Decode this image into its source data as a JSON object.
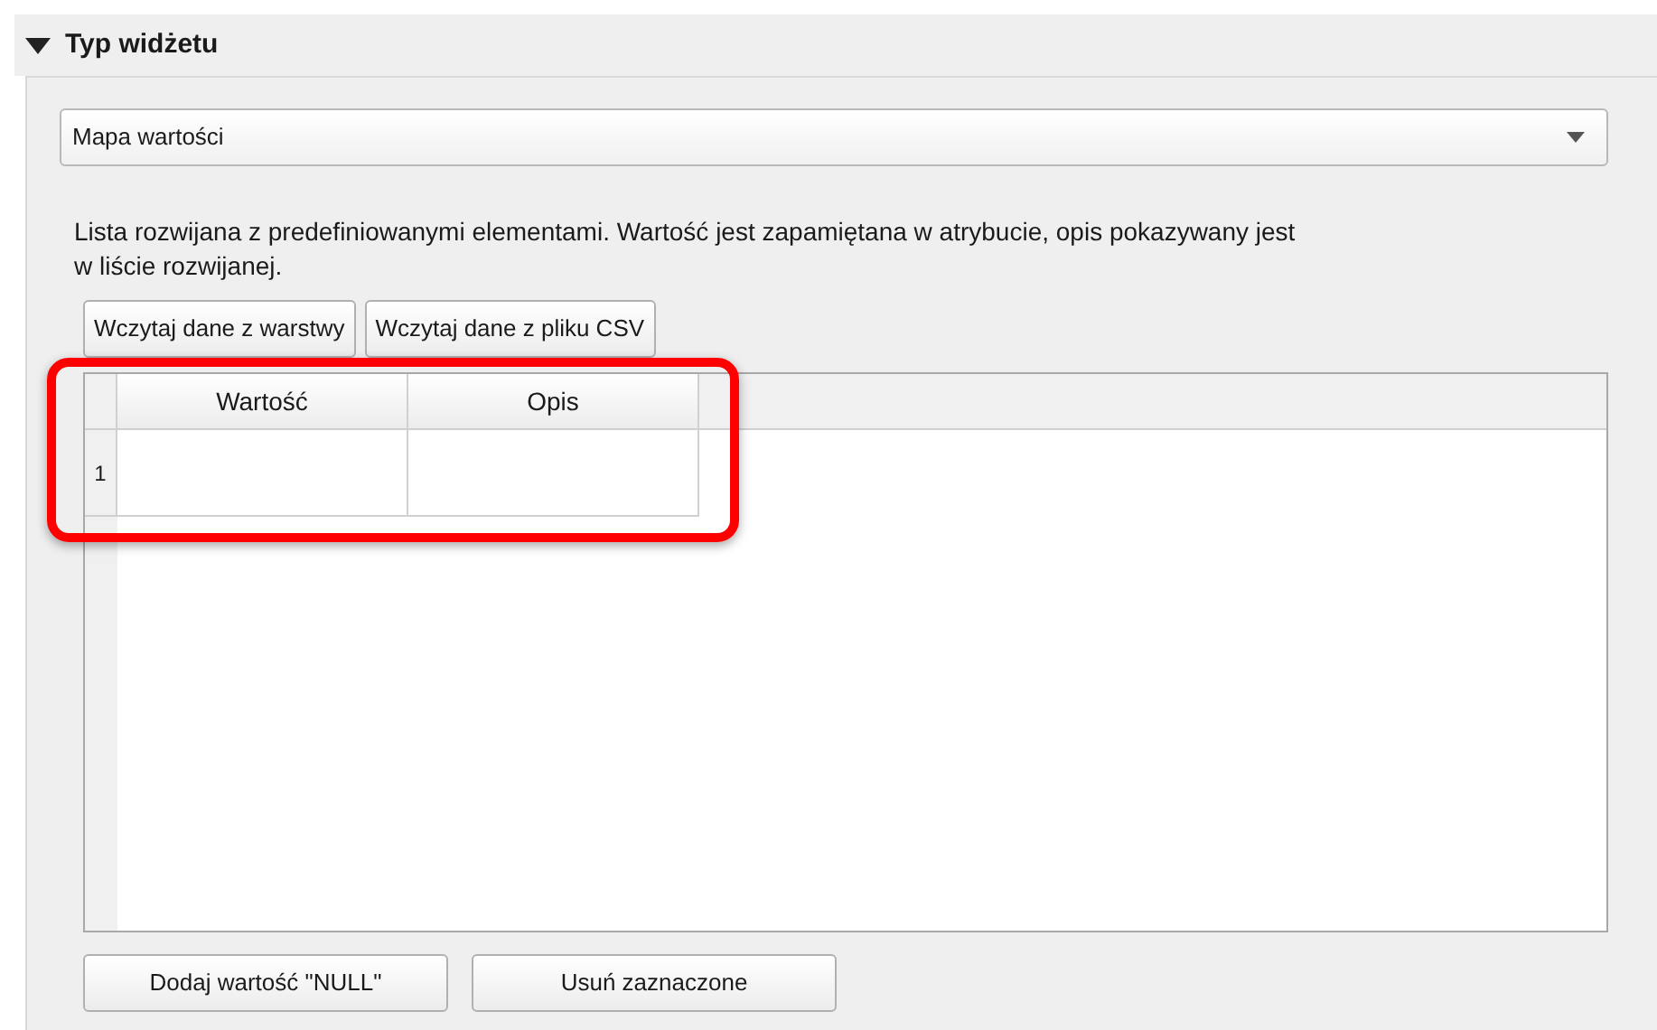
{
  "section": {
    "title": "Typ widżetu",
    "expanded": true
  },
  "widget_type": {
    "value": "Mapa wartości"
  },
  "description": "Lista rozwijana z predefiniowanymi elementami. Wartość jest zapamiętana w atrybucie, opis pokazywany jest w liście rozwijanej.",
  "load_buttons": [
    "Wczytaj dane z warstwy",
    "Wczytaj dane z pliku CSV"
  ],
  "table": {
    "highlighted": true,
    "columns": [
      "Wartość",
      "Opis"
    ],
    "rows": [
      {
        "number": "1"
      }
    ]
  },
  "bottom_buttons": [
    "Dodaj wartość \"NULL\"",
    "Usuń zaznaczone"
  ]
}
